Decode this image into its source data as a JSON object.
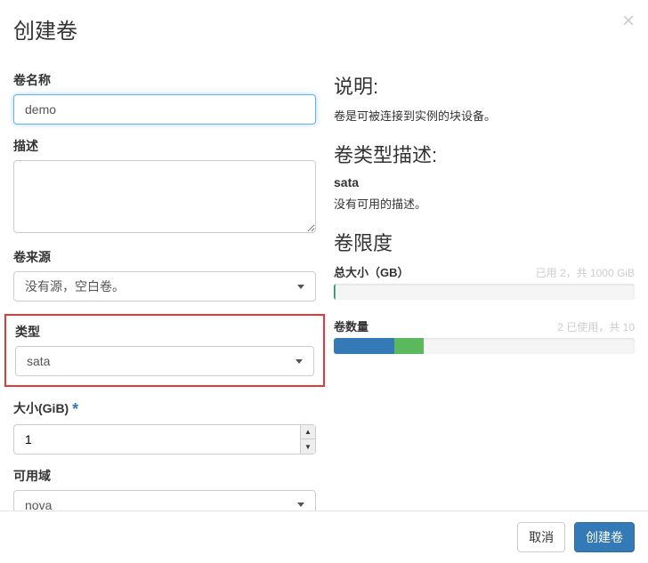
{
  "header": {
    "title": "创建卷"
  },
  "form": {
    "name_label": "卷名称",
    "name_value": "demo",
    "desc_label": "描述",
    "desc_value": "",
    "source_label": "卷来源",
    "source_value": "没有源，空白卷。",
    "type_label": "类型",
    "type_value": "sata",
    "size_label": "大小(GiB)",
    "size_value": "1",
    "az_label": "可用域",
    "az_value": "nova"
  },
  "info": {
    "explain_title": "说明:",
    "explain_text": "卷是可被连接到实例的块设备。",
    "type_desc_title": "卷类型描述:",
    "type_desc_sub": "sata",
    "type_desc_text": "没有可用的描述。",
    "limits_title": "卷限度"
  },
  "quota": {
    "total_size_label": "总大小（GB）",
    "total_size_info": "已用 2，共 1000 GiB",
    "total_size_used_pct": 0.2,
    "total_size_new_pct": 0.1,
    "volumes_label": "卷数量",
    "volumes_info": "2 已使用，共 10",
    "volumes_used_pct": 20,
    "volumes_new_pct": 10
  },
  "footer": {
    "cancel": "取消",
    "submit": "创建卷"
  }
}
